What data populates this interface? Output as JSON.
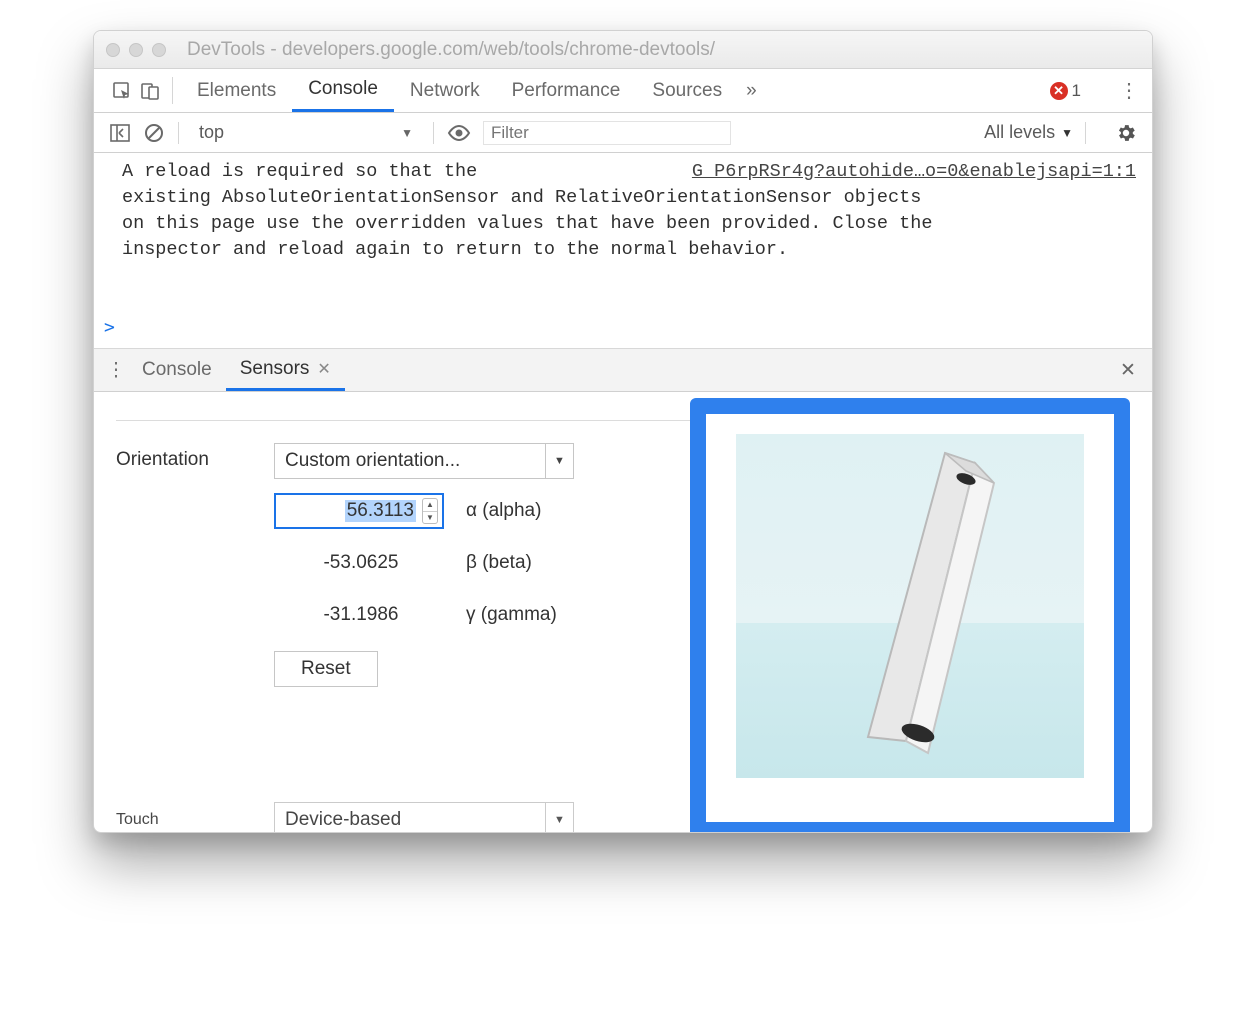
{
  "titlebar": {
    "title": "DevTools - developers.google.com/web/tools/chrome-devtools/"
  },
  "maintabs": {
    "items": [
      "Elements",
      "Console",
      "Network",
      "Performance",
      "Sources"
    ],
    "active_index": 1,
    "more_glyph": "»",
    "error_count": "1"
  },
  "console_toolbar": {
    "context": "top",
    "filter_placeholder": "Filter",
    "levels_label": "All levels"
  },
  "console": {
    "source_link": "G P6rpRSr4g?autohide…o=0&enablejsapi=1:1",
    "msg_line1": "A reload is required so that the ",
    "msg_line2": "existing AbsoluteOrientationSensor and RelativeOrientationSensor objects",
    "msg_line3": "on this page use the overridden values that have been provided. Close the",
    "msg_line4": "inspector and reload again to return to the normal behavior.",
    "prompt": ">"
  },
  "drawer": {
    "tabs": [
      "Console",
      "Sensors"
    ],
    "active_index": 1
  },
  "sensors": {
    "orientation_label": "Orientation",
    "orientation_select": "Custom orientation...",
    "alpha_value": "56.3113",
    "alpha_label": "α (alpha)",
    "beta_value": "-53.0625",
    "beta_label": "β (beta)",
    "gamma_value": "-31.1986",
    "gamma_label": "γ (gamma)",
    "reset_label": "Reset",
    "touch_label": "Touch",
    "touch_select": "Device-based"
  }
}
